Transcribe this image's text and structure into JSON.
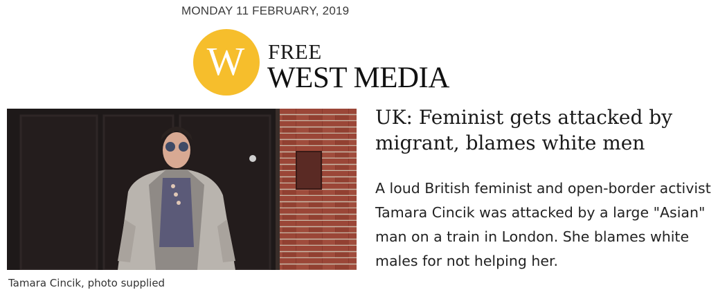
{
  "header": {
    "date": "MONDAY 11 FEBRUARY, 2019",
    "logo_letter": "W",
    "logo_line1": "FREE",
    "logo_line2": "WEST MEDIA",
    "logo_color": "#f6be2c"
  },
  "article": {
    "headline": "UK: Feminist gets attacked by migrant, blames white men",
    "summary": "A loud British feminist and open-border activist Tamara Cincik was attacked by a large \"Asian\" man on a train in London. She blames white males for not helping her.",
    "photo_caption": "Tamara Cincik, photo supplied"
  }
}
